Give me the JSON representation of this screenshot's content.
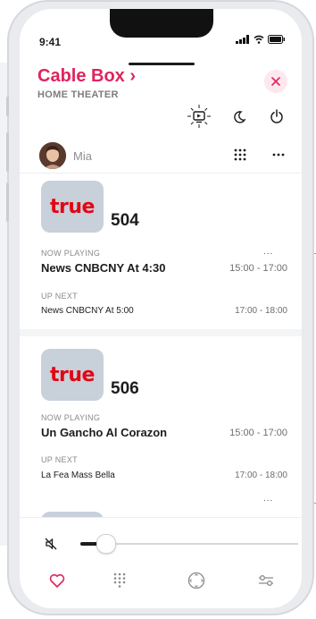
{
  "status_bar": {
    "time": "9:41"
  },
  "header": {
    "title": "Cable Box ›",
    "subtitle": "HOME THEATER",
    "accent_color": "#e0245e"
  },
  "toolbar": {
    "icons": [
      "tv-source-icon",
      "moon-icon",
      "power-icon"
    ]
  },
  "user": {
    "name": "Mia"
  },
  "channels": [
    {
      "logo_text": "true",
      "number": "504",
      "now_playing_label": "NOW PLAYING",
      "now_title": "News CNBCNY At  4:30",
      "now_time": "15:00 - 17:00",
      "up_next_label": "UP NEXT",
      "next_title": "News CNBCNY At 5:00",
      "next_time": "17:00 - 18:00",
      "more": "..."
    },
    {
      "logo_text": "true",
      "number": "506",
      "now_playing_label": "NOW PLAYING",
      "now_title": "Un Gancho Al Corazon",
      "now_time": "15:00 - 17:00",
      "up_next_label": "UP NEXT",
      "next_title": "La Fea Mass Bella",
      "next_time": "17:00 - 18:00",
      "more": "..."
    }
  ],
  "volume": {
    "level": 0.08,
    "muted": true
  },
  "tab_bar": [
    "favorites-icon",
    "keypad-icon",
    "dpad-icon",
    "settings-icon"
  ]
}
